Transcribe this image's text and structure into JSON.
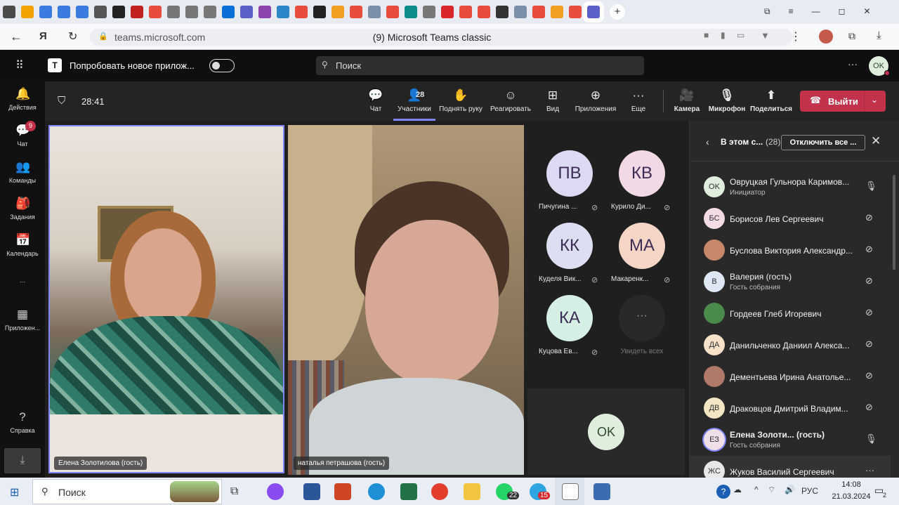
{
  "browser": {
    "tab_icon_colors": [
      "#4a4a4a",
      "#f2a300",
      "#3a7be0",
      "#3a7be0",
      "#3a7be0",
      "#555",
      "#222",
      "#c02020",
      "#e74c3c",
      "#777",
      "#777",
      "#777",
      "#0a6fd8",
      "#5b5fc7",
      "#8e44ad",
      "#2d86c7",
      "#e74c3c",
      "#222",
      "#f0a020",
      "#e74c3c",
      "#7b8fa8",
      "#e74c3c",
      "#0e8b8b",
      "#777",
      "#d9262b",
      "#e74c3c",
      "#e74c3c",
      "#333",
      "#7b8fa8",
      "#e74c3c",
      "#f0a020",
      "#e74c3c",
      "#5b5fc7"
    ],
    "url": "teams.microsoft.com",
    "page_title": "(9) Microsoft Teams classic"
  },
  "teams_header": {
    "try_new_label": "Попробовать новое прилож...",
    "search_placeholder": "Поиск",
    "more": "···",
    "user_initials": "OK"
  },
  "rail": [
    {
      "label": "Действия",
      "icon": "bell-icon",
      "glyph": "🔔"
    },
    {
      "label": "Чат",
      "icon": "chat-icon",
      "glyph": "💬",
      "badge": "9"
    },
    {
      "label": "Команды",
      "icon": "teams-icon",
      "glyph": "👥"
    },
    {
      "label": "Задания",
      "icon": "assignments-icon",
      "glyph": "🎒"
    },
    {
      "label": "Календарь",
      "icon": "calendar-icon",
      "glyph": "📅"
    },
    {
      "label": "···",
      "icon": "more-icon",
      "glyph": ""
    },
    {
      "label": "Приложен...",
      "icon": "apps-icon",
      "glyph": "▦"
    },
    {
      "label": "Справка",
      "icon": "help-icon",
      "glyph": "?"
    }
  ],
  "meeting": {
    "timer": "28:41",
    "participants_count": "28",
    "toolbar": [
      {
        "label": "Чат",
        "icon": "chat-icon",
        "glyph": "💬"
      },
      {
        "label": "Участники",
        "icon": "people-icon",
        "glyph": "👤"
      },
      {
        "label": "Поднять руку",
        "icon": "hand-icon",
        "glyph": "✋"
      },
      {
        "label": "Реагировать",
        "icon": "emoji-icon",
        "glyph": "☺"
      },
      {
        "label": "Вид",
        "icon": "view-icon",
        "glyph": "⊞"
      },
      {
        "label": "Приложения",
        "icon": "add-app-icon",
        "glyph": "⊕"
      },
      {
        "label": "Еще",
        "icon": "more-icon",
        "glyph": "···"
      }
    ],
    "media": [
      {
        "label": "Камера",
        "icon": "camera-off-icon",
        "glyph": "🎥"
      },
      {
        "label": "Микрофон",
        "icon": "mic-icon",
        "glyph": "🎙"
      },
      {
        "label": "Поделиться",
        "icon": "share-icon",
        "glyph": "⬆"
      }
    ],
    "leave_label": "Выйти",
    "videos": [
      {
        "name": "Елена Золотилова (гость)"
      },
      {
        "name": "наталья петрашова (гость)"
      }
    ],
    "gallery": [
      {
        "initials": "ПВ",
        "name": "Пичугина ...",
        "color": "#dcd9f2"
      },
      {
        "initials": "КВ",
        "name": "Курило Ди...",
        "color": "#f2d9e6"
      },
      {
        "initials": "КК",
        "name": "Куделя Вик...",
        "color": "#dcdff2"
      },
      {
        "initials": "МА",
        "name": "Макаренк...",
        "color": "#f5d5c6"
      },
      {
        "initials": "КА",
        "name": "Куцова Ев...",
        "color": "#d6efe4"
      }
    ],
    "see_all": "Увидеть всех",
    "self_initials": "OK"
  },
  "panel": {
    "title": "В этом с...",
    "count": "(28)",
    "mute_all": "Отключить все ...",
    "participants": [
      {
        "initials": "OK",
        "name": "Овруцкая Гульнора Каримов...",
        "sub": "Инициатор",
        "color": "#dfeedd",
        "mic": "on"
      },
      {
        "initials": "БС",
        "name": "Борисов Лев Сергеевич",
        "sub": "",
        "color": "#f5dbe6",
        "mic": "off"
      },
      {
        "initials": "",
        "name": "Буслова Виктория Александр...",
        "sub": "",
        "color": "#c7876b",
        "mic": "off"
      },
      {
        "initials": "В",
        "name": "Валерия (гость)",
        "sub": "Гость собрания",
        "color": "#dfe7f5",
        "mic": "off"
      },
      {
        "initials": "",
        "name": "Гордеев Глеб Игоревич",
        "sub": "",
        "color": "#4a8a4a",
        "mic": "off"
      },
      {
        "initials": "ДА",
        "name": "Данильченко Даниил Алекса...",
        "sub": "",
        "color": "#f7e1c8",
        "mic": "off"
      },
      {
        "initials": "",
        "name": "Дементьева Ирина Анатолье...",
        "sub": "",
        "color": "#b07a6a",
        "mic": "off"
      },
      {
        "initials": "ДВ",
        "name": "Драковцов Дмитрий Владим...",
        "sub": "",
        "color": "#f3e6c4",
        "mic": "off"
      },
      {
        "initials": "ЕЗ",
        "name": "Елена Золоти...  (гость)",
        "sub": "Гость собрания",
        "color": "#f0dfe9",
        "mic": "on"
      },
      {
        "initials": "ЖС",
        "name": "Жуков Василий Сергеевич",
        "sub": "",
        "color": "#e8e8e8",
        "mic": "more"
      }
    ]
  },
  "taskbar": {
    "search_label": "Поиск",
    "whatsapp_badge": "22",
    "telegram_badge": "15",
    "lang": "РУС",
    "time": "14:08",
    "date": "21.03.2024",
    "notif_count": "2"
  }
}
